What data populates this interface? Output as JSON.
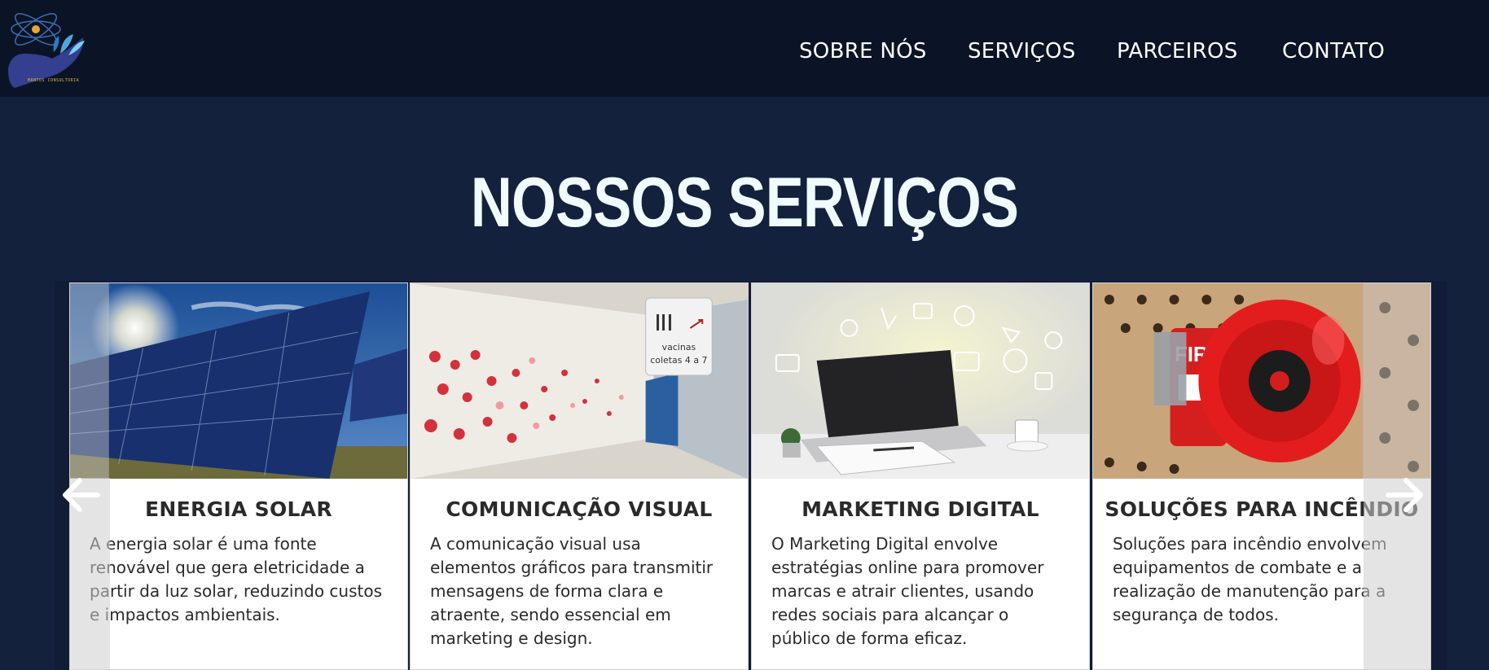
{
  "header": {
    "logo_text": "MANTOS CONSULTORIA",
    "nav": [
      {
        "label": "SOBRE NÓS"
      },
      {
        "label": "SERVIÇOS"
      },
      {
        "label": "PARCEIROS"
      },
      {
        "label": "CONTATO"
      }
    ]
  },
  "services": {
    "title": "NOSSOS SERVIÇOS",
    "cards": [
      {
        "title": "ENERGIA SOLAR",
        "text": "A energia solar é uma fonte renovável que gera eletricidade a partir da luz solar, reduzindo custos e impactos ambientais."
      },
      {
        "title": "COMUNICAÇÃO VISUAL",
        "text": "A comunicação visual usa elementos gráficos para transmitir mensagens de forma clara e atraente, sendo essencial em marketing e design.",
        "image_sign": [
          "vacinas",
          "coletas 4 a 7"
        ]
      },
      {
        "title": "MARKETING DIGITAL",
        "text": "O Marketing Digital envolve estratégias online para promover marcas e atrair clientes, usando redes sociais para alcançar o público de forma eficaz."
      },
      {
        "title": "SOLUÇÕES PARA INCÊNDIO",
        "text": "Soluções para incêndio envolvem equipamentos de combate e a realização de manutenção para a segurança de todos.",
        "image_sign": "FIRE"
      }
    ],
    "prev_icon": "arrow-left-icon",
    "next_icon": "arrow-right-icon"
  },
  "colors": {
    "header_bg": "#0b1426",
    "page_bg": "#14213d",
    "title": "#f0fbff"
  }
}
